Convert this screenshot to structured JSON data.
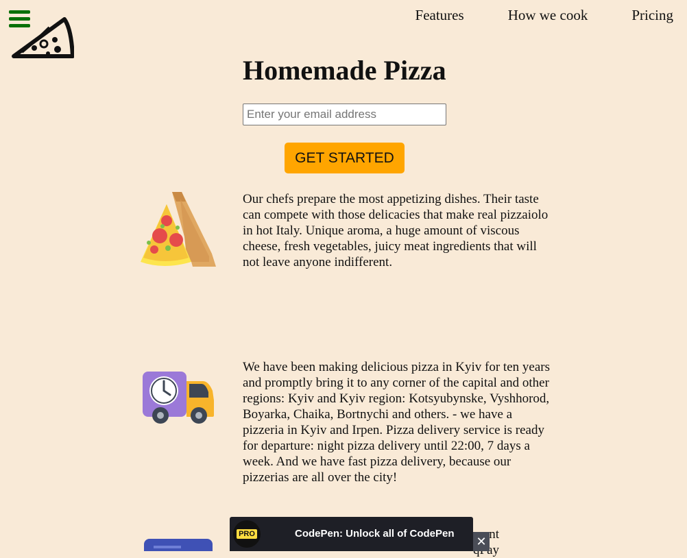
{
  "nav": {
    "menu_icon": "hamburger-icon",
    "logo_icon": "pizza-slice-logo-icon",
    "links": [
      {
        "label": "Features"
      },
      {
        "label": "How we cook"
      },
      {
        "label": "Pricing"
      }
    ]
  },
  "hero": {
    "title": "Homemade Pizza",
    "email_placeholder": "Enter your email address",
    "cta_label": "GET STARTED"
  },
  "features": [
    {
      "icon": "pizza-box-icon",
      "text": "Our chefs prepare the most appetizing dishes. Their taste can compete with those delicacies that make real pizzaiolo in hot Italy. Unique aroma, a huge amount of viscous cheese, fresh vegetables, juicy meat ingredients that will not leave anyone indifferent."
    },
    {
      "icon": "delivery-truck-icon",
      "text": "We have been making delicious pizza in Kyiv for ten years and promptly bring it to any corner of the capital and other regions: Kyiv and Kyiv region: Kotsyubynske, Vyshhorod, Boyarka, Chaika, Bortnychi and others. - we have a pizzeria in Kyiv and Irpen. Pizza delivery service is ready for departure: night pizza delivery until 22:00, 7 days a week. And we have fast pizza delivery, because our pizzerias are all over the city!"
    },
    {
      "icon": "payment-card-icon",
      "text": "ment\nqPay"
    }
  ],
  "banner": {
    "badge": "PRO",
    "text": "CodePen: Unlock all of CodePen",
    "close": "✕"
  },
  "colors": {
    "background": "#f9ead7",
    "accent": "#ffa500",
    "menu_icon": "#087008",
    "banner": "#1e1f26"
  }
}
